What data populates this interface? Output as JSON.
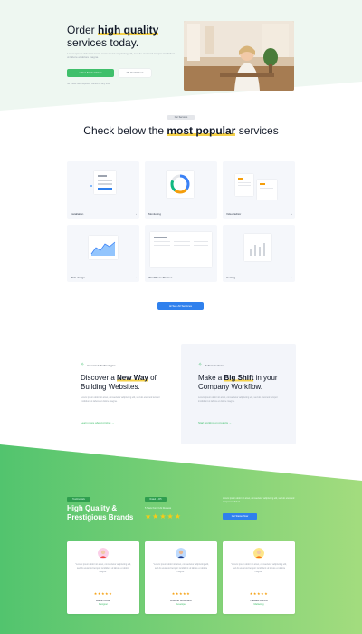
{
  "hero": {
    "title_pre": "Order ",
    "title_highlight": "high quality",
    "title_post": "services today.",
    "subtitle": "Lorem ipsum dolor sit amet, consectetur adipiscing elit, sed do eiusmod tempor incididunt ut labore et dolore magna.",
    "primary_button": "Get Started Now",
    "secondary_button": "Contact us",
    "note": "No credit card required. Cancel at any time."
  },
  "services": {
    "tag": "Our Services",
    "title_pre": "Check below the ",
    "title_bold": "most popular",
    "title_post": " services",
    "cards": [
      {
        "label": "Installation"
      },
      {
        "label": "Monitoring"
      },
      {
        "label": "Video Editor"
      },
      {
        "label": "Web design"
      },
      {
        "label": "WordPress Themes"
      },
      {
        "label": "Hosting"
      }
    ],
    "all_button": "See All Services"
  },
  "features": [
    {
      "label": "Advanced Technologies",
      "title_pre": "Discover a ",
      "title_bold": "New Way",
      "title_post": " of Building Websites.",
      "text": "Lorem ipsum dolor sit amet, consectetur adipiscing elit, sed do eiusmod tempor incididunt ut labore et dolore magna.",
      "link": "Learn more about pricing"
    },
    {
      "label": "Robust Features",
      "title_pre": "Make a ",
      "title_bold": "Big Shift",
      "title_post": " in your Company Workflow.",
      "text": "Lorem ipsum dolor sit amet, consectetur adipiscing elit, sed do eiusmod tempor incididunt ut labore et dolore magna.",
      "link": "Start working on projects"
    }
  ],
  "testimonials": {
    "badge": "Testimonials",
    "title": "High Quality & Prestigious Brands",
    "rating_badge": "Rated 4.9/5",
    "rating_text": "5 Stars from 3.2k Reviews",
    "stars": "★★★★★",
    "right_text": "Lorem ipsum dolor sit amet, consectetur adipiscing elit, sed do eiusmod tempor incididunt.",
    "right_button": "Get Started Now",
    "cards": [
      {
        "quote": "\"Lorem ipsum dolor sit amet, consectetur adipiscing elit, sed do eiusmod tempor incididunt ut labore et dolore magna.\"",
        "stars": "★★★★★",
        "name": "Maria Cloud",
        "role": "Designer",
        "avatar_color": "#fbcfe8"
      },
      {
        "quote": "\"Lorem ipsum dolor sit amet, consectetur adipiscing elit, sed do eiusmod tempor incididunt ut labore et dolore magna.\"",
        "stars": "★★★★★",
        "name": "Antonio Hoffmann",
        "role": "Developer",
        "avatar_color": "#bfdbfe"
      },
      {
        "quote": "\"Lorem ipsum dolor sit amet, consectetur adipiscing elit, sed do eiusmod tempor incididunt ut labore et dolore magna.\"",
        "stars": "★★★★★",
        "name": "Natalia Herold",
        "role": "Marketing",
        "avatar_color": "#fde68a"
      }
    ]
  },
  "colors": {
    "accent_green": "#3fbf6b",
    "accent_blue": "#2f80ed",
    "highlight_yellow": "#f6d24a"
  }
}
